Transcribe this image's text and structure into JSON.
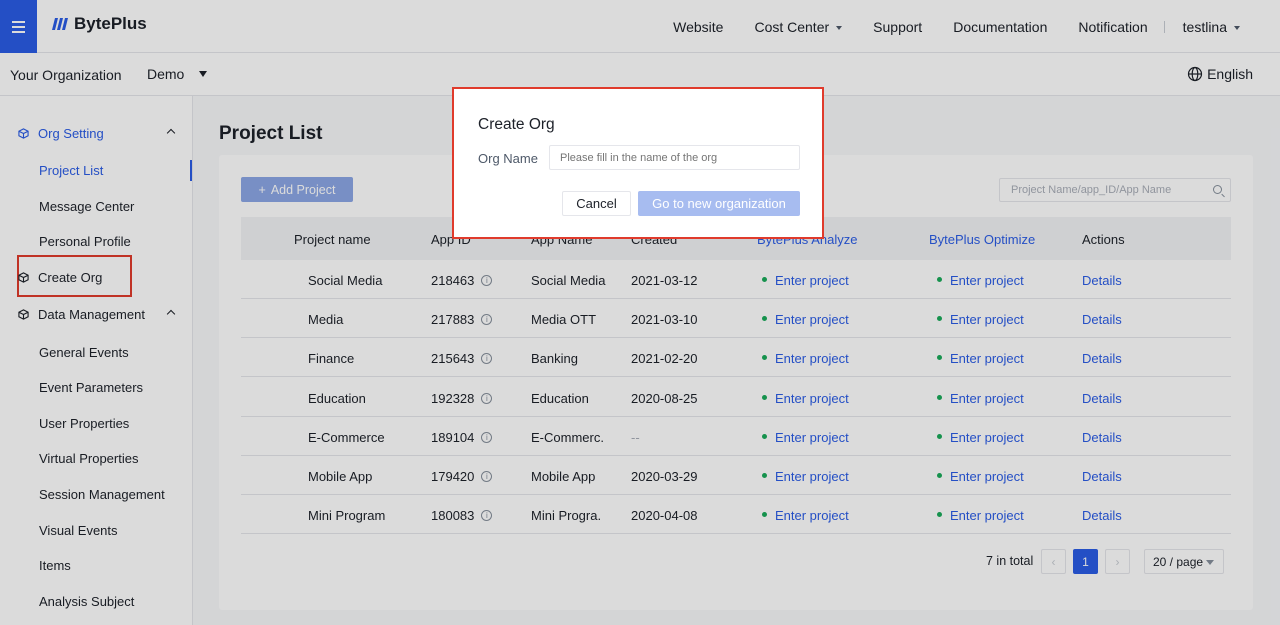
{
  "header": {
    "brand": "BytePlus",
    "nav": [
      "Website",
      "Cost Center",
      "Support",
      "Documentation",
      "Notification"
    ],
    "user": "testlina"
  },
  "orgbar": {
    "label": "Your Organization",
    "selected_org": "Demo",
    "language": "English"
  },
  "sidebar": {
    "org_setting": "Org Setting",
    "org_items": [
      "Project List",
      "Message Center",
      "Personal Profile"
    ],
    "create_org": "Create Org",
    "data_management": "Data Management",
    "data_items": [
      "General Events",
      "Event Parameters",
      "User Properties",
      "Virtual Properties",
      "Session Management",
      "Visual Events",
      "Items",
      "Analysis Subject"
    ]
  },
  "main": {
    "title": "Project List",
    "add_project": "Add Project",
    "search_placeholder": "Project Name/app_ID/App Name",
    "columns": [
      "Project name",
      "App ID",
      "App Name",
      "Created",
      "BytePlus Analyze",
      "BytePlus Optimize",
      "Actions"
    ],
    "rows": [
      {
        "name": "Social Media",
        "app_id": "218463",
        "app_name": "Social Media",
        "created": "2021-03-12",
        "analyze": "Enter project",
        "optimize": "Enter project",
        "action": "Details"
      },
      {
        "name": "Media",
        "app_id": "217883",
        "app_name": "Media OTT",
        "created": "2021-03-10",
        "analyze": "Enter project",
        "optimize": "Enter project",
        "action": "Details"
      },
      {
        "name": "Finance",
        "app_id": "215643",
        "app_name": "Banking",
        "created": "2021-02-20",
        "analyze": "Enter project",
        "optimize": "Enter project",
        "action": "Details"
      },
      {
        "name": "Education",
        "app_id": "192328",
        "app_name": "Education",
        "created": "2020-08-25",
        "analyze": "Enter project",
        "optimize": "Enter project",
        "action": "Details"
      },
      {
        "name": "E-Commerce",
        "app_id": "189104",
        "app_name": "E-Commerc.",
        "created": "--",
        "analyze": "Enter project",
        "optimize": "Enter project",
        "action": "Details"
      },
      {
        "name": "Mobile App",
        "app_id": "179420",
        "app_name": "Mobile App",
        "created": "2020-03-29",
        "analyze": "Enter project",
        "optimize": "Enter project",
        "action": "Details"
      },
      {
        "name": "Mini Program",
        "app_id": "180083",
        "app_name": "Mini Progra.",
        "created": "2020-04-08",
        "analyze": "Enter project",
        "optimize": "Enter project",
        "action": "Details"
      }
    ],
    "pagination": {
      "total": "7 in total",
      "current_page": "1",
      "page_size": "20 / page"
    }
  },
  "modal": {
    "title": "Create Org",
    "org_name_label": "Org Name",
    "org_name_placeholder": "Please fill in the name of the org",
    "org_name_value": "",
    "cancel": "Cancel",
    "confirm": "Go to new organization"
  },
  "colors": {
    "accent": "#2b5ce6",
    "highlight_border": "#e03b2c",
    "status_green": "#1aab5a"
  }
}
